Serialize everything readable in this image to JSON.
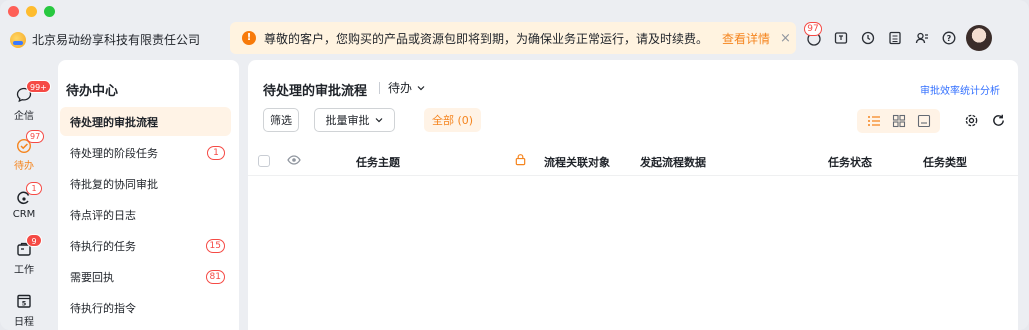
{
  "company": {
    "name": "北京易动纷享科技有限责任公司"
  },
  "notice": {
    "text": "尊敬的客户，您购买的产品或资源包即将到期，为确保业务正常运行，请及时续费。",
    "link": "查看详情",
    "close": "×"
  },
  "topbar": {
    "badge": "97"
  },
  "rail": {
    "items": [
      {
        "label": "企信",
        "badge": "99+",
        "icon": "chat-icon"
      },
      {
        "label": "待办",
        "badge": "97",
        "icon": "todo-check-icon"
      },
      {
        "label": "CRM",
        "badge": "1",
        "icon": "crm-icon"
      },
      {
        "label": "工作",
        "badge": "9",
        "icon": "work-icon"
      },
      {
        "label": "日程",
        "badge": "",
        "icon": "calendar-icon"
      }
    ]
  },
  "subnav": {
    "title": "待办中心",
    "items": [
      {
        "label": "待处理的审批流程",
        "count": ""
      },
      {
        "label": "待处理的阶段任务",
        "count": "1"
      },
      {
        "label": "待批复的协同审批",
        "count": ""
      },
      {
        "label": "待点评的日志",
        "count": ""
      },
      {
        "label": "待执行的任务",
        "count": "15"
      },
      {
        "label": "需要回执",
        "count": "81"
      },
      {
        "label": "待执行的指令",
        "count": ""
      }
    ]
  },
  "main": {
    "title": "待处理的审批流程",
    "view": "待办",
    "stats_link": "审批效率统计分析",
    "filter_btn": "筛选",
    "batch_btn": "批量审批",
    "all_tab": "全部 (0)"
  },
  "table": {
    "columns": [
      "任务主题",
      "流程关联对象",
      "发起流程数据",
      "任务状态",
      "任务类型"
    ]
  },
  "colors": {
    "accent": "#f5851f",
    "link": "#3370ff",
    "badge": "#f54a45"
  }
}
